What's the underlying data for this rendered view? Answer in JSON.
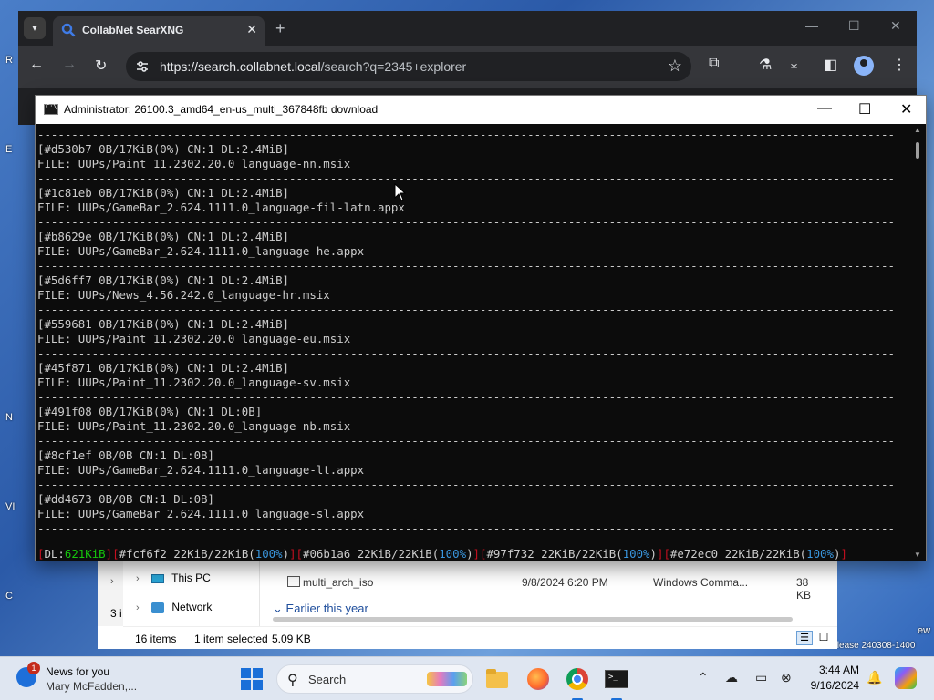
{
  "desktop": {
    "fragments": [
      "R",
      "E",
      "N",
      "VI",
      "C"
    ],
    "right_fragments": [
      "ew",
      "Release 240308-1400"
    ]
  },
  "browser": {
    "tab_title": "CollabNet SearXNG",
    "tab_close": "✕",
    "new_tab": "+",
    "url_host": "https://search.collabnet.local",
    "url_path": "/search?q=2345+explorer",
    "win_min": "—",
    "win_max": "☐",
    "win_close": "✕",
    "back": "←",
    "forward": "→",
    "reload": "↻"
  },
  "console": {
    "title": "Administrator:  26100.3_amd64_en-us_multi_367848fb download",
    "separator": "------------------------------------------------------------------------------------------------------------------------------",
    "entries": [
      {
        "status": "[#d530b7 0B/17KiB(0%) CN:1 DL:2.4MiB]",
        "file": "FILE: UUPs/Paint_11.2302.20.0_language-nn.msix"
      },
      {
        "status": "[#1c81eb 0B/17KiB(0%) CN:1 DL:2.4MiB]",
        "file": "FILE: UUPs/GameBar_2.624.1111.0_language-fil-latn.appx"
      },
      {
        "status": "[#b8629e 0B/17KiB(0%) CN:1 DL:2.4MiB]",
        "file": "FILE: UUPs/GameBar_2.624.1111.0_language-he.appx"
      },
      {
        "status": "[#5d6ff7 0B/17KiB(0%) CN:1 DL:2.4MiB]",
        "file": "FILE: UUPs/News_4.56.242.0_language-hr.msix"
      },
      {
        "status": "[#559681 0B/17KiB(0%) CN:1 DL:2.4MiB]",
        "file": "FILE: UUPs/Paint_11.2302.20.0_language-eu.msix"
      },
      {
        "status": "[#45f871 0B/17KiB(0%) CN:1 DL:2.4MiB]",
        "file": "FILE: UUPs/Paint_11.2302.20.0_language-sv.msix"
      },
      {
        "status": "[#491f08 0B/17KiB(0%) CN:1 DL:0B]",
        "file": "FILE: UUPs/Paint_11.2302.20.0_language-nb.msix"
      },
      {
        "status": "[#8cf1ef 0B/0B CN:1 DL:0B]",
        "file": "FILE: UUPs/GameBar_2.624.1111.0_language-lt.appx"
      },
      {
        "status": "[#dd4673 0B/0B CN:1 DL:0B]",
        "file": "FILE: UUPs/GameBar_2.624.1111.0_language-sl.appx"
      }
    ],
    "summary": {
      "dl_label": "DL:",
      "dl_value": "621KiB",
      "items": [
        {
          "id": "#fcf6f2",
          "size": "22KiB/22KiB",
          "pct": "100%"
        },
        {
          "id": "#06b1a6",
          "size": "22KiB/22KiB",
          "pct": "100%"
        },
        {
          "id": "#97f732",
          "size": "22KiB/22KiB",
          "pct": "100%"
        },
        {
          "id": "#e72ec0",
          "size": "22KiB/22KiB",
          "pct": "100%"
        }
      ]
    }
  },
  "explorer": {
    "tree": [
      "This PC",
      "Network"
    ],
    "row": {
      "name": "multi_arch_iso",
      "date": "9/8/2024 6:20 PM",
      "type": "Windows Comma...",
      "size": "38 KB"
    },
    "group": "Earlier this year",
    "status": {
      "items": "16 items",
      "selected": "1 item selected",
      "size": "5.09 KB"
    },
    "left_fragment": "3 i"
  },
  "taskbar": {
    "weather_title": "News for you",
    "weather_sub": "Mary McFadden,...",
    "weather_badge": "1",
    "search_label": "Search",
    "time": "3:44 AM",
    "date": "9/16/2024"
  }
}
